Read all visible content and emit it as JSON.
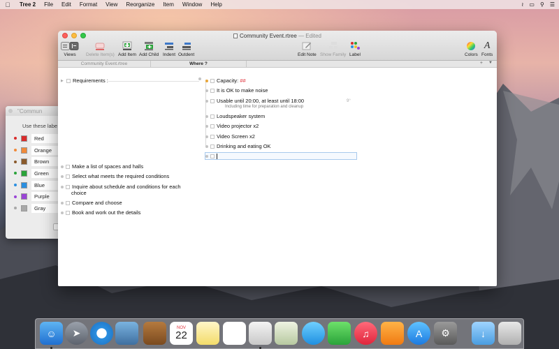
{
  "menubar": {
    "app": "Tree 2",
    "items": [
      "File",
      "Edit",
      "Format",
      "View",
      "Reorganize",
      "Item",
      "Window",
      "Help"
    ]
  },
  "palette": {
    "title": "\"Commun",
    "hint": "Use these labe",
    "labels": [
      {
        "name": "Red",
        "color": "#d92b2b"
      },
      {
        "name": "Orange",
        "color": "#f08a3a"
      },
      {
        "name": "Brown",
        "color": "#8a5a2b"
      },
      {
        "name": "Green",
        "color": "#2aa33a"
      },
      {
        "name": "Blue",
        "color": "#2b8fe0"
      },
      {
        "name": "Purple",
        "color": "#9a45d6"
      },
      {
        "name": "Gray",
        "color": "#a8a8a8"
      }
    ]
  },
  "window": {
    "title": "Community Event.rtree",
    "edited": "— Edited",
    "toolbar": {
      "views": "Views",
      "delete": "Delete Item(s)",
      "add_item": "Add Item",
      "add_child": "Add Child",
      "indent": "Indent",
      "outdent": "Outdent",
      "edit_note": "Edit Note",
      "show_family": "Show Family",
      "label": "Label",
      "colors": "Colors",
      "fonts": "Fonts"
    },
    "tabs": [
      "Community Event.rtree",
      "Where ?"
    ]
  },
  "tree": {
    "root": "Requirements :",
    "children": [
      {
        "text": "Capacity: ",
        "value": "##"
      },
      {
        "text": "It is OK to make noise"
      },
      {
        "text": "Usable until 20:00, at least until 18:00",
        "note": "Including time for preparation and cleanup",
        "badge": "9°"
      },
      {
        "text": "Loudspeaker system"
      },
      {
        "text": "Video projector x2"
      },
      {
        "text": "Video Screen x2"
      },
      {
        "text": "Drinking and eating OK"
      }
    ],
    "tasks": [
      "Make a list of spaces and halls",
      "Select what meets the required conditions",
      "Inquire about schedule and conditions for each",
      "choice",
      "Compare and choose",
      "Book and work out the details"
    ]
  },
  "dock": {
    "calendar_month": "NOV",
    "calendar_day": "22"
  },
  "colors": {
    "accent": "#e0333c",
    "edit_border": "#a8c9ec"
  }
}
